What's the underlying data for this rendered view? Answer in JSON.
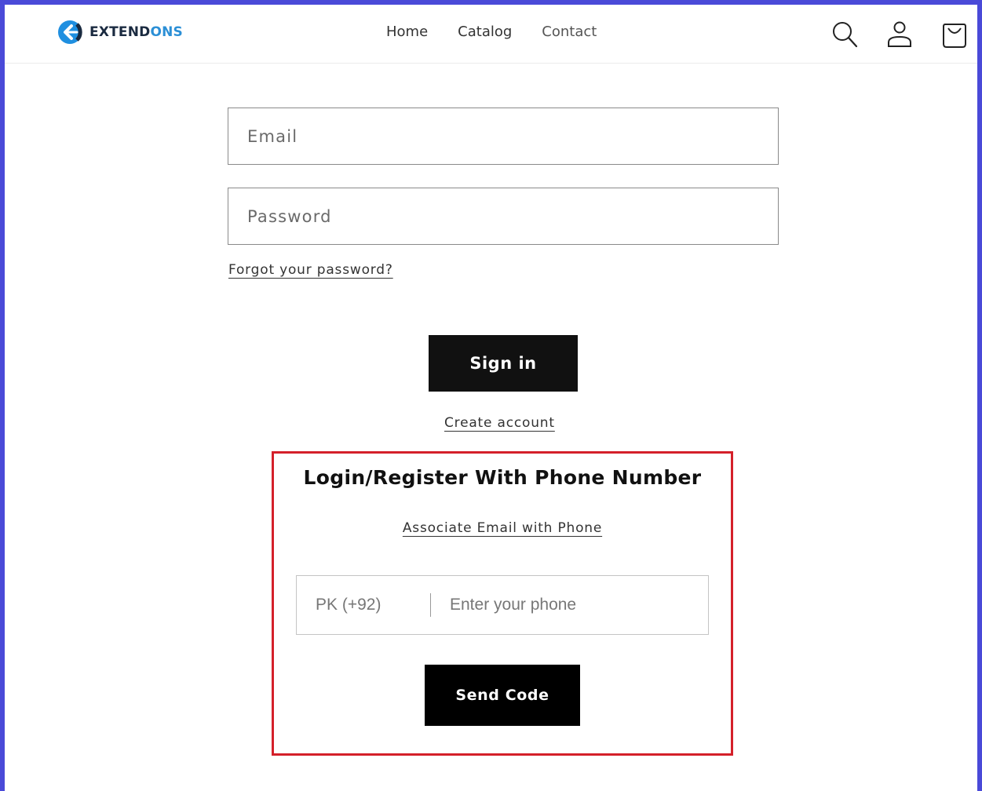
{
  "brand": {
    "name_main": "EXTEND",
    "name_accent": "ONS",
    "accent_color": "#2b8fd6"
  },
  "nav": {
    "items": [
      "Home",
      "Catalog",
      "Contact"
    ]
  },
  "header_icons": [
    "search-icon",
    "account-icon",
    "cart-icon"
  ],
  "login": {
    "email_placeholder": "Email",
    "password_placeholder": "Password",
    "forgot_password": "Forgot your password?",
    "sign_in": "Sign in",
    "create_account": "Create account"
  },
  "phone_login": {
    "title": "Login/Register With Phone Number",
    "associate_link": "Associate Email with Phone",
    "country_code": "PK (+92)",
    "phone_placeholder": "Enter your phone",
    "send_code": "Send Code",
    "highlight_color": "#d4202a"
  }
}
